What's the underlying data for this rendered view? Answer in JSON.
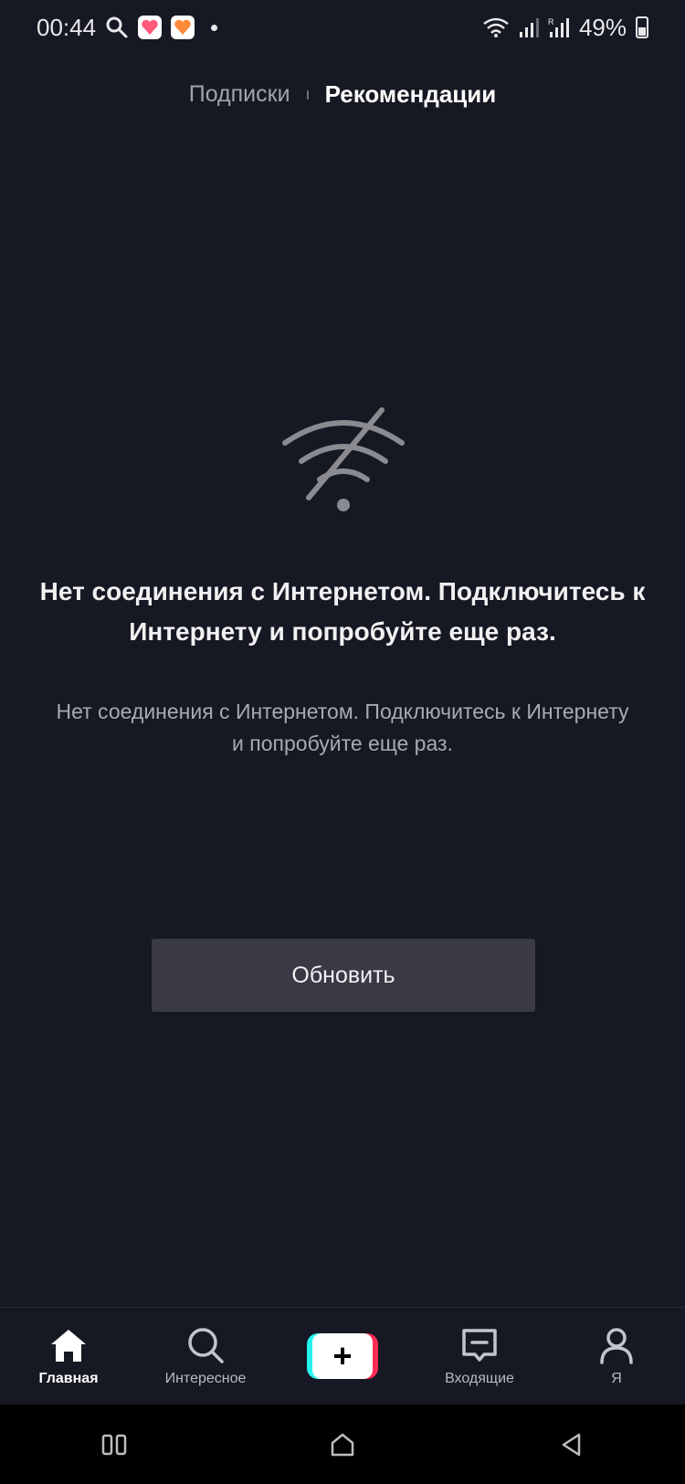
{
  "status_bar": {
    "time": "00:44",
    "battery": "49%"
  },
  "top_tabs": {
    "following": "Подписки",
    "for_you": "Рекомендации"
  },
  "error": {
    "title": "Нет соединения с Интернетом. Подключитесь к Интернету и попробуйте еще раз.",
    "description": "Нет соединения с Интернетом. Подключитесь к Интернету и попробуйте еще раз.",
    "refresh_label": "Обновить"
  },
  "bottom_nav": {
    "home": "Главная",
    "discover": "Интересное",
    "inbox": "Входящие",
    "profile": "Я"
  },
  "colors": {
    "background": "#161823",
    "button": "#393a45",
    "accent_cyan": "#25f4ee",
    "accent_pink": "#fe2c55"
  }
}
